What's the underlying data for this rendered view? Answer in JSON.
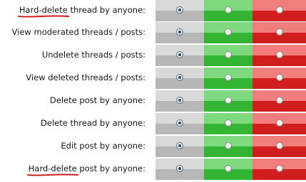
{
  "permissions": [
    {
      "highlight": "Hard-delete",
      "rest": " thread by anyone:",
      "selected": "gray"
    },
    {
      "highlight": "",
      "rest": "View moderated threads / posts:",
      "selected": "gray"
    },
    {
      "highlight": "",
      "rest": "Undelete threads / posts:",
      "selected": "gray"
    },
    {
      "highlight": "",
      "rest": "View deleted threads / posts:",
      "selected": "gray"
    },
    {
      "highlight": "",
      "rest": "Delete post by anyone:",
      "selected": "gray"
    },
    {
      "highlight": "",
      "rest": "Delete thread by anyone:",
      "selected": "gray"
    },
    {
      "highlight": "",
      "rest": "Edit post by anyone:",
      "selected": "gray"
    },
    {
      "highlight": "Hard-delete",
      "rest": " post by anyone:",
      "selected": "gray"
    }
  ],
  "colors": {
    "neutral": "#b7b7b7",
    "allow": "#33b533",
    "deny": "#d01d1d",
    "annotation_underline": "#d11a1a"
  }
}
